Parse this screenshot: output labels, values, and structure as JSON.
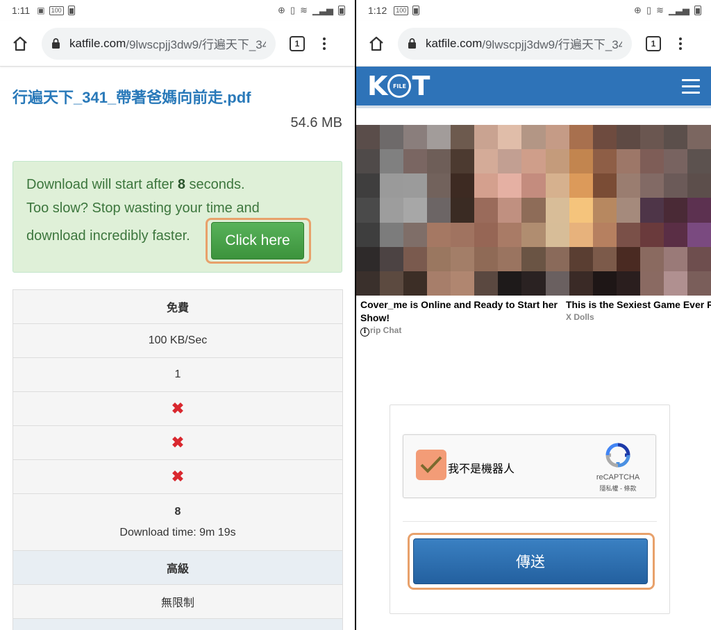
{
  "left": {
    "status": {
      "time": "1:11",
      "battery": "100"
    },
    "browser": {
      "url_domain": "katfile.com",
      "url_path": "/9lwscpjj3dw9/行遍天下_34",
      "tab_count": "1"
    },
    "file": {
      "title": "行遍天下_341_帶著爸媽向前走.pdf",
      "size": "54.6 MB"
    },
    "alert": {
      "line1_prefix": "Download will start after ",
      "seconds": "8",
      "line1_suffix": " seconds.",
      "line2": "Too slow? Stop wasting your time and",
      "line3": "download incredibly faster.",
      "button": "Click here"
    },
    "plan_table": {
      "free_header": "免費",
      "speed": "100 KB/Sec",
      "value_1": "1",
      "x_mark": "✖",
      "wait": "8",
      "download_time": "Download time: 9m 19s",
      "premium_header": "高級",
      "unlimited": "無限制"
    }
  },
  "right": {
    "status": {
      "time": "1:12",
      "battery": "100"
    },
    "browser": {
      "url_domain": "katfile.com",
      "url_path": "/9lwscpjj3dw9/行遍天下_34",
      "tab_count": "1"
    },
    "site": {
      "logo_k": "K",
      "logo_file": "FILE",
      "logo_t": "T"
    },
    "ads": [
      {
        "title": "Cover_me is Online and Ready to Start her Show!",
        "source": "rip Chat"
      },
      {
        "title": "This is the Sexiest Game Ever Re",
        "source": "X Dolls"
      }
    ],
    "captcha": {
      "label": "我不是機器人",
      "brand": "reCAPTCHA",
      "links": "隱私權 - 條款"
    },
    "submit": "傳送"
  },
  "colors": {
    "link_blue": "#2979b9",
    "alert_green_bg": "#dff0d8",
    "click_green": "#4aa34b",
    "highlight_orange": "#e8a16b",
    "kat_blue": "#2e73b8",
    "submit_blue": "#2b6cad"
  }
}
